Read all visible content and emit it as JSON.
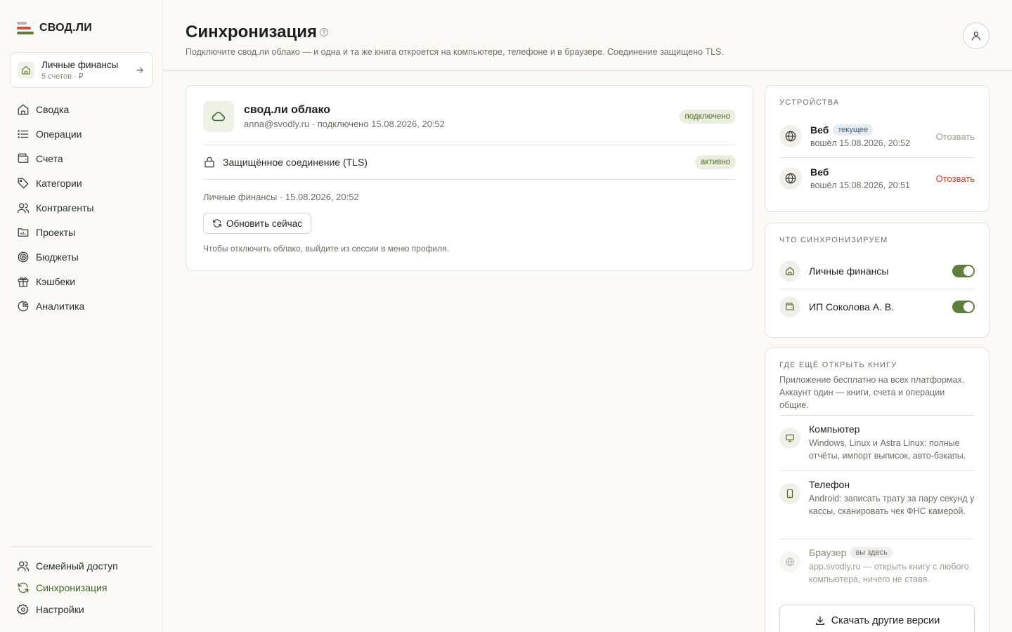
{
  "app": {
    "name": "СВОД.ЛИ"
  },
  "book": {
    "title": "Личные финансы",
    "subtitle": "5 счетов · ₽"
  },
  "nav": [
    {
      "label": "Сводка",
      "icon": "home-icon"
    },
    {
      "label": "Операции",
      "icon": "list-icon"
    },
    {
      "label": "Счета",
      "icon": "wallet-icon"
    },
    {
      "label": "Категории",
      "icon": "tag-icon"
    },
    {
      "label": "Контрагенты",
      "icon": "users-icon"
    },
    {
      "label": "Проекты",
      "icon": "folder-chart-icon"
    },
    {
      "label": "Бюджеты",
      "icon": "target-icon"
    },
    {
      "label": "Кэшбеки",
      "icon": "gift-icon"
    },
    {
      "label": "Аналитика",
      "icon": "pie-chart-icon"
    }
  ],
  "nav_bottom": [
    {
      "label": "Семейный доступ",
      "icon": "users-icon"
    },
    {
      "label": "Синхронизация",
      "icon": "sync-icon",
      "active": true
    },
    {
      "label": "Настройки",
      "icon": "gear-icon"
    }
  ],
  "header": {
    "title": "Синхронизация",
    "subtitle": "Подключите свод.ли облако — и одна и та же книга откроется на компьютере, телефоне и в браузере. Соединение защищено TLS."
  },
  "cloud": {
    "title": "свод.ли облако",
    "subtitle": "anna@svodly.ru · подключено 15.08.2026, 20:52",
    "status": "подключено",
    "tls_label": "Защищённое соединение (TLS)",
    "tls_status": "активно",
    "book_meta": "Личные финансы · 15.08.2026, 20:52",
    "refresh_label": "Обновить сейчас",
    "note": "Чтобы отключить облако, выйдите из сессии в меню профиля."
  },
  "devices": {
    "title": "УСТРОЙСТВА",
    "items": [
      {
        "name": "Веб",
        "tag": "текущее",
        "time": "вошёл 15.08.2026, 20:52",
        "action": "Отозвать"
      },
      {
        "name": "Веб",
        "tag": "",
        "time": "вошёл 15.08.2026, 20:51",
        "action": "Отозвать"
      }
    ]
  },
  "sync": {
    "title": "ЧТО СИНХРОНИЗИРУЕМ",
    "items": [
      {
        "label": "Личные финансы",
        "enabled": true
      },
      {
        "label": "ИП Соколова А. В.",
        "enabled": true
      }
    ]
  },
  "where": {
    "title": "ГДЕ ЕЩЁ ОТКРЫТЬ КНИГУ",
    "intro": "Приложение бесплатно на всех платформах. Аккаунт один — книги, счета и операции общие.",
    "items": [
      {
        "name": "Компьютер",
        "desc": "Windows, Linux и Astra Linux: полные отчёты, импорт выписок, авто-бэкапы.",
        "tag": ""
      },
      {
        "name": "Телефон",
        "desc": "Android: записать трату за пару секунд у кассы, сканировать чек ФНС камерой.",
        "tag": ""
      },
      {
        "name": "Браузер",
        "desc": "app.svodly.ru — открыть книгу с любого компьютера, ничего не ставя.",
        "tag": "вы здесь"
      }
    ],
    "download_label": "Скачать другие версии"
  },
  "colors": {
    "accent": "#5f7f3e",
    "danger": "#b8452a",
    "brand_red": "#c2593a"
  }
}
